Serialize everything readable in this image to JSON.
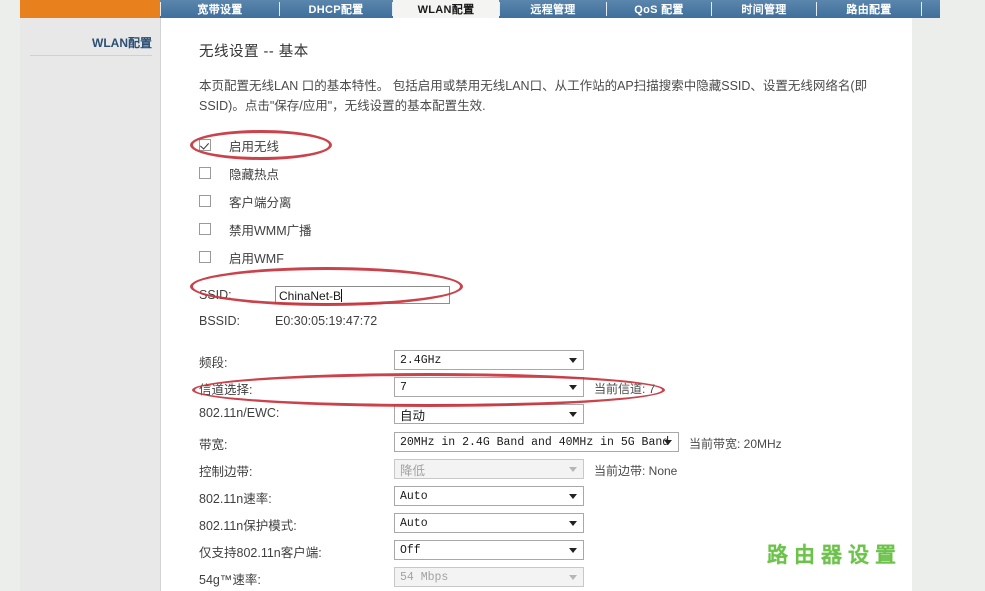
{
  "nav": {
    "items": [
      {
        "label": "宽带设置",
        "active": false
      },
      {
        "label": "DHCP配置",
        "active": false
      },
      {
        "label": "WLAN配置",
        "active": true
      },
      {
        "label": "远程管理",
        "active": false
      },
      {
        "label": "QoS 配置",
        "active": false
      },
      {
        "label": "时间管理",
        "active": false
      },
      {
        "label": "路由配置",
        "active": false
      }
    ],
    "brand_color": "#e8801e",
    "bar_color": "#4a7ba7"
  },
  "sidebar": {
    "items": [
      {
        "label": "WLAN配置"
      }
    ]
  },
  "main": {
    "title": "无线设置 -- 基本",
    "description": "本页配置无线LAN 口的基本特性。 包括启用或禁用无线LAN口、从工作站的AP扫描搜索中隐藏SSID、设置无线网络名(即SSID)。点击\"保存/应用\"，无线设置的基本配置生效.",
    "checkboxes": [
      {
        "label": "启用无线",
        "checked": true
      },
      {
        "label": "隐藏热点",
        "checked": false
      },
      {
        "label": "客户端分离",
        "checked": false
      },
      {
        "label": "禁用WMM广播",
        "checked": false
      },
      {
        "label": "启用WMF",
        "checked": false
      }
    ],
    "ssid": {
      "label": "SSID:",
      "value": "ChinaNet-B"
    },
    "bssid": {
      "label": "BSSID:",
      "value": "E0:30:05:19:47:72"
    },
    "fields": [
      {
        "label": "频段:",
        "value": "2.4GHz",
        "note": "",
        "disabled": false,
        "mono": true
      },
      {
        "label": "信道选择:",
        "value": "7",
        "note": "当前信道: 7",
        "disabled": false,
        "mono": true
      },
      {
        "label": "802.11n/EWC:",
        "value": "自动",
        "note": "",
        "disabled": false,
        "mono": false
      },
      {
        "label": "带宽:",
        "value": "20MHz in 2.4G Band and 40MHz in 5G Band",
        "note": "当前带宽: 20MHz",
        "disabled": false,
        "mono": true
      },
      {
        "label": "控制边带:",
        "value": "降低",
        "note": "当前边带: None",
        "disabled": true,
        "mono": false
      },
      {
        "label": "802.11n速率:",
        "value": "Auto",
        "note": "",
        "disabled": false,
        "mono": true
      },
      {
        "label": "802.11n保护模式:",
        "value": "Auto",
        "note": "",
        "disabled": false,
        "mono": true
      },
      {
        "label": "仅支持802.11n客户端:",
        "value": "Off",
        "note": "",
        "disabled": false,
        "mono": true
      },
      {
        "label": "54g™速率:",
        "value": "54 Mbps",
        "note": "",
        "disabled": true,
        "mono": true
      }
    ]
  },
  "annotations": {
    "color": "#c8323c",
    "regions": [
      {
        "name": "enable-wireless-highlight"
      },
      {
        "name": "ssid-highlight"
      },
      {
        "name": "channel-highlight"
      }
    ]
  },
  "watermark": {
    "text": "路由器设置",
    "color": "#6cc24a"
  }
}
